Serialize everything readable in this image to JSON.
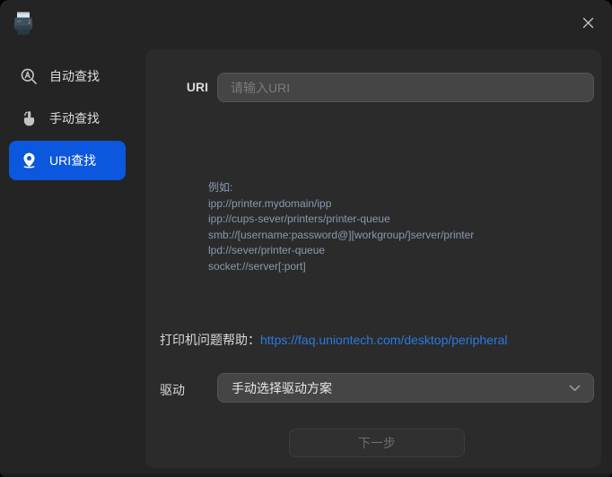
{
  "window": {
    "app_icon": "printer-icon",
    "close_icon": "close-x"
  },
  "sidebar": {
    "items": [
      {
        "label": "自动查找",
        "icon": "auto-search-icon",
        "selected": false
      },
      {
        "label": "手动查找",
        "icon": "hand-touch-icon",
        "selected": false
      },
      {
        "label": "URI查找",
        "icon": "location-pin-icon",
        "selected": true
      }
    ]
  },
  "main": {
    "uri_field": {
      "label": "URI",
      "value": "",
      "placeholder": "请输入URI"
    },
    "examples": {
      "title": "例如:",
      "lines": [
        "ipp://printer.mydomain/ipp",
        "ipp://cups-sever/printers/printer-queue",
        "smb://[username:password@][workgroup/]server/printer",
        "lpd://sever/printer-queue",
        "socket://server[:port]"
      ]
    },
    "help": {
      "label": "打印机问题帮助：",
      "link_text": "https://faq.uniontech.com/desktop/peripheral"
    },
    "driver": {
      "label": "驱动",
      "selected_option": "手动选择驱动方案"
    },
    "next_button": {
      "label": "下一步",
      "state": "disabled"
    }
  },
  "colors": {
    "accent_blue": "#0b57dd",
    "link_blue": "#2a7ae0",
    "example_text": "#8a99b0",
    "panel_bg": "#2b2b2b",
    "window_bg": "#242424"
  }
}
